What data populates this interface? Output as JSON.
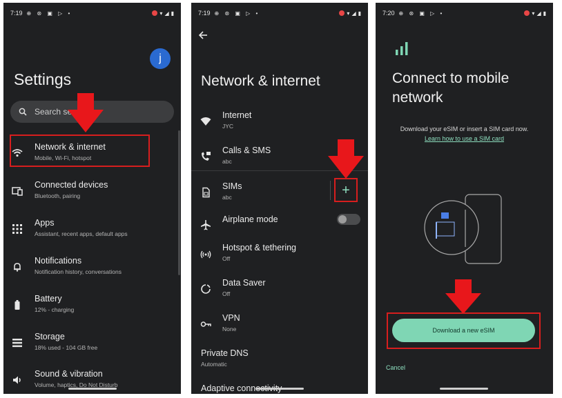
{
  "screen1": {
    "status": {
      "time": "7:19",
      "icons": "⊕ ⊛ ▣ ▷ •"
    },
    "avatar_letter": "j",
    "title": "Settings",
    "search": {
      "placeholder": "Search se"
    },
    "items": [
      {
        "title": "Network & internet",
        "subtitle": "Mobile, Wi-Fi, hotspot",
        "icon": "wifi-icon"
      },
      {
        "title": "Connected devices",
        "subtitle": "Bluetooth, pairing",
        "icon": "devices-icon"
      },
      {
        "title": "Apps",
        "subtitle": "Assistant, recent apps, default apps",
        "icon": "apps-grid-icon"
      },
      {
        "title": "Notifications",
        "subtitle": "Notification history, conversations",
        "icon": "bell-icon"
      },
      {
        "title": "Battery",
        "subtitle": "12% - charging",
        "icon": "battery-icon"
      },
      {
        "title": "Storage",
        "subtitle": "18% used - 104 GB free",
        "icon": "storage-icon"
      },
      {
        "title": "Sound & vibration",
        "subtitle": "Volume, haptics, Do Not Disturb",
        "icon": "speaker-icon"
      }
    ]
  },
  "screen2": {
    "status": {
      "time": "7:19",
      "icons": "⊕ ⊛ ▣ ▷ •"
    },
    "title": "Network & internet",
    "items": [
      {
        "title": "Internet",
        "subtitle": "JYC",
        "icon": "wifi-icon"
      },
      {
        "title": "Calls & SMS",
        "subtitle": "abc",
        "icon": "calls-sms-icon"
      },
      {
        "title": "SIMs",
        "subtitle": "abc",
        "icon": "sim-icon"
      },
      {
        "title": "Airplane mode",
        "subtitle": "",
        "icon": "airplane-icon"
      },
      {
        "title": "Hotspot & tethering",
        "subtitle": "Off",
        "icon": "hotspot-icon"
      },
      {
        "title": "Data Saver",
        "subtitle": "Off",
        "icon": "data-saver-icon"
      },
      {
        "title": "VPN",
        "subtitle": "None",
        "icon": "vpn-key-icon"
      },
      {
        "title": "Private DNS",
        "subtitle": "Automatic",
        "icon": ""
      },
      {
        "title": "Adaptive connectivity",
        "subtitle": "",
        "icon": ""
      }
    ],
    "add_sim_symbol": "+",
    "airplane_toggle": "off"
  },
  "screen3": {
    "status": {
      "time": "7:20",
      "icons": "⊕ ⊛ ▣ ▷ •"
    },
    "title_line1": "Connect to mobile",
    "title_line2": "network",
    "description": "Download your eSIM or insert a SIM card now.",
    "learn_link": "Learn how to use a SIM card",
    "download_button": "Download a new eSIM",
    "cancel": "Cancel"
  },
  "colors": {
    "background": "#1f2022",
    "highlight_red": "#d81e1e",
    "accent_teal": "#7fd6b4",
    "avatar_blue": "#2a6ad1"
  }
}
